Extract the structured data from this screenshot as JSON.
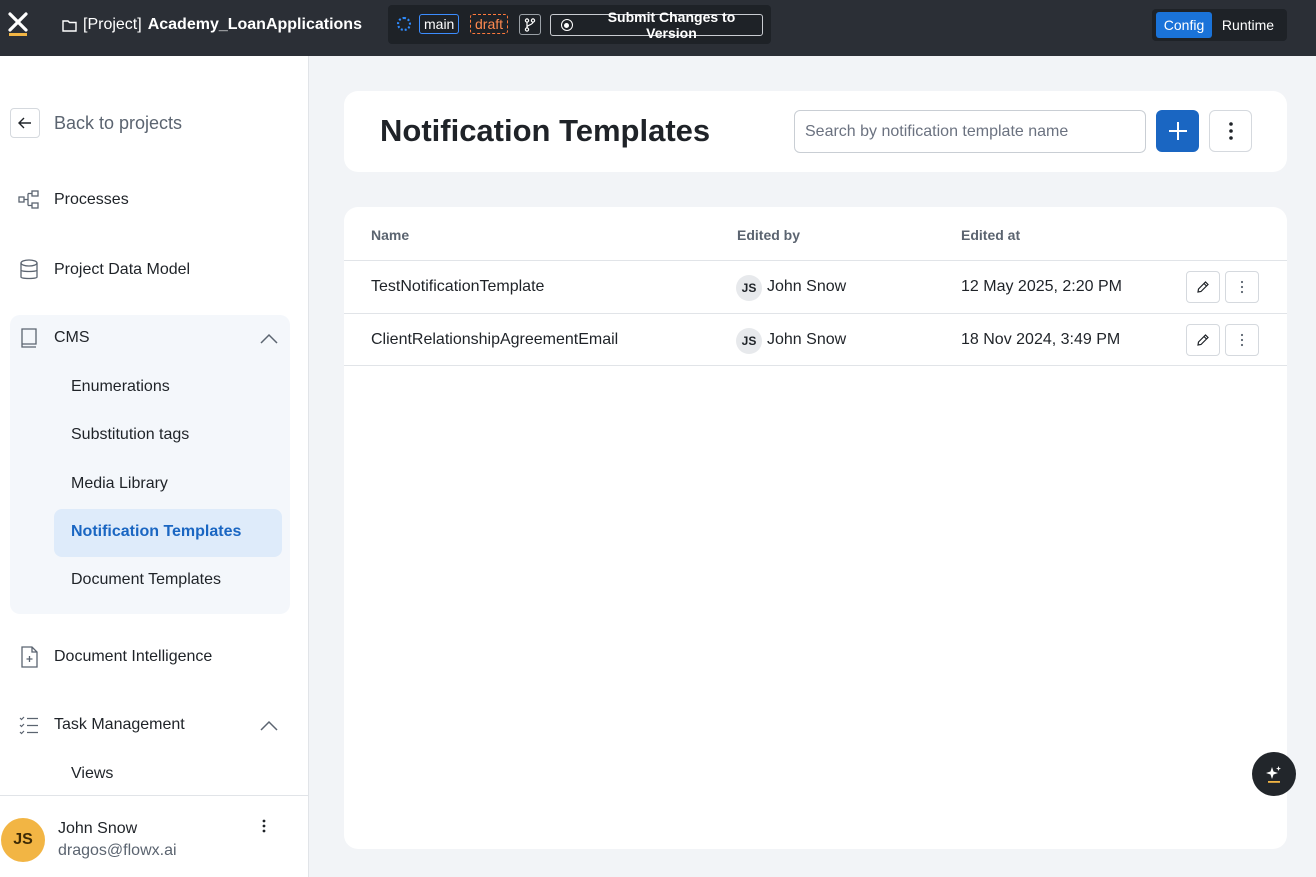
{
  "topbar": {
    "project_prefix": "[Project]",
    "project_name": "Academy_LoanApplications",
    "branch": "main",
    "status": "draft",
    "submit_label": "Submit Changes to Version",
    "mode_config": "Config",
    "mode_runtime": "Runtime"
  },
  "sidebar": {
    "back_label": "Back to projects",
    "items": [
      {
        "label": "Processes",
        "icon": "processes-icon"
      },
      {
        "label": "Project Data Model",
        "icon": "database-icon"
      },
      {
        "label": "CMS",
        "icon": "book-icon"
      },
      {
        "label": "Document Intelligence",
        "icon": "document-plus-icon"
      },
      {
        "label": "Task Management",
        "icon": "task-list-icon"
      }
    ],
    "cms_children": [
      "Enumerations",
      "Substitution tags",
      "Media Library",
      "Notification Templates",
      "Document Templates"
    ],
    "task_children": [
      "Views"
    ],
    "user": {
      "initials": "JS",
      "name": "John Snow",
      "email": "dragos@flowx.ai"
    }
  },
  "main": {
    "title": "Notification Templates",
    "search_placeholder": "Search by notification template name",
    "columns": {
      "name": "Name",
      "edited_by": "Edited by",
      "edited_at": "Edited at"
    },
    "rows": [
      {
        "name": "TestNotificationTemplate",
        "initials": "JS",
        "edited_by": "John Snow",
        "edited_at": "12 May 2025, 2:20 PM"
      },
      {
        "name": "ClientRelationshipAgreementEmail",
        "initials": "JS",
        "edited_by": "John Snow",
        "edited_at": "18 Nov 2024, 3:49 PM"
      }
    ]
  },
  "colors": {
    "topbar": "#2b2f36",
    "accent": "#1a66c2",
    "active_bg": "#deebfa",
    "avatar": "#f2b544",
    "draft": "#ff7a3c"
  }
}
